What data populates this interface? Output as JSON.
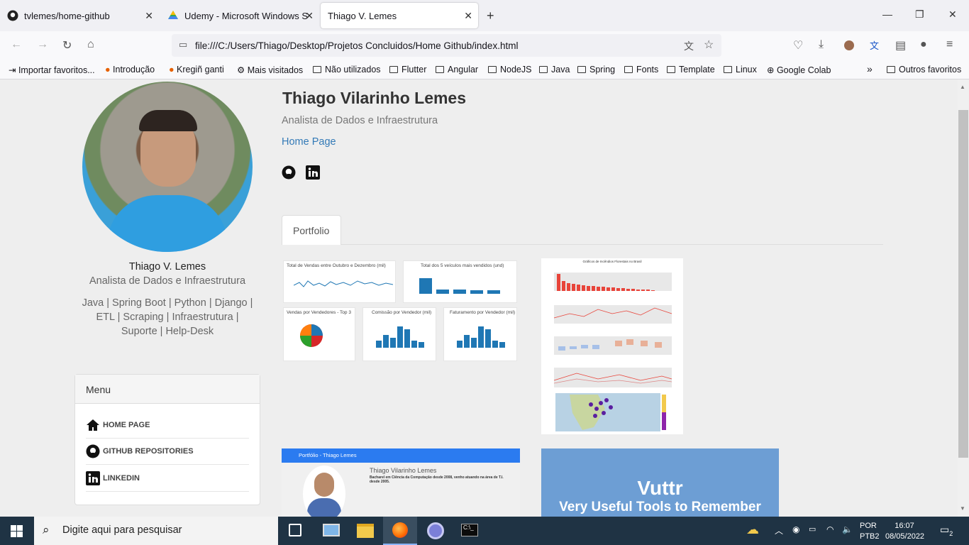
{
  "tabs": [
    {
      "label": "tvlemes/home-github",
      "icon": "github-icon"
    },
    {
      "label": "Udemy - Microsoft Windows Se",
      "icon": "drive-icon"
    },
    {
      "label": "Thiago V. Lemes",
      "icon": "none"
    }
  ],
  "url": "file:///C:/Users/Thiago/Desktop/Projetos Concluidos/Home Github/index.html",
  "bookmarks": [
    "Importar favoritos...",
    "Introdução",
    "Kregiñ ganti",
    "Mais visitados",
    "Não utilizados",
    "Flutter",
    "Angular",
    "NodeJS",
    "Java",
    "Spring",
    "Fonts",
    "Template",
    "Linux",
    "Google Colab"
  ],
  "other_bookmarks": "Outros favoritos",
  "profile": {
    "name": "Thiago V. Lemes",
    "role": "Analista de Dados e Infraestrutura",
    "skills_line1": "Java | Spring Boot | Python | Django |",
    "skills_line2": "ETL | Scraping | Infraestrutura |",
    "skills_line3": "Suporte | Help-Desk"
  },
  "menu": {
    "title": "Menu",
    "items": [
      "HOME PAGE",
      "GITHUB REPOSITORIES",
      "LINKEDIN"
    ]
  },
  "main": {
    "title": "Thiago Vilarinho Lemes",
    "subtitle": "Analista de Dados e Infraestrutura",
    "home_link": "Home Page",
    "tab": "Portfolio"
  },
  "cards": {
    "sales_titles": [
      "Total de Vendas entre Outubro e Dezembro (mil)",
      "Total dos 5 veículos mais vendidos (und)",
      "Vendas por Vendedores - Top 3",
      "Comissão por Vendedor (mil)",
      "Faturamento por Vendedor (mil)"
    ],
    "incidents_title": "Gráficos de Incêndios Florestais no Brasil",
    "portfolio_bar": "Portfólio - Thiago Lemes",
    "portfolio_name": "Thiago Vilarinho Lemes",
    "portfolio_text": "Bacharel em Ciência da Computação desde 2008, venho atuando na área de T.I. desde 2005.",
    "vuttr_title": "Vuttr",
    "vuttr_sub": "Very Useful Tools to Remember"
  },
  "taskbar": {
    "search_placeholder": "Digite aqui para pesquisar",
    "lang1": "POR",
    "lang2": "PTB2",
    "time": "16:07",
    "date": "08/05/2022",
    "notif": "2"
  }
}
